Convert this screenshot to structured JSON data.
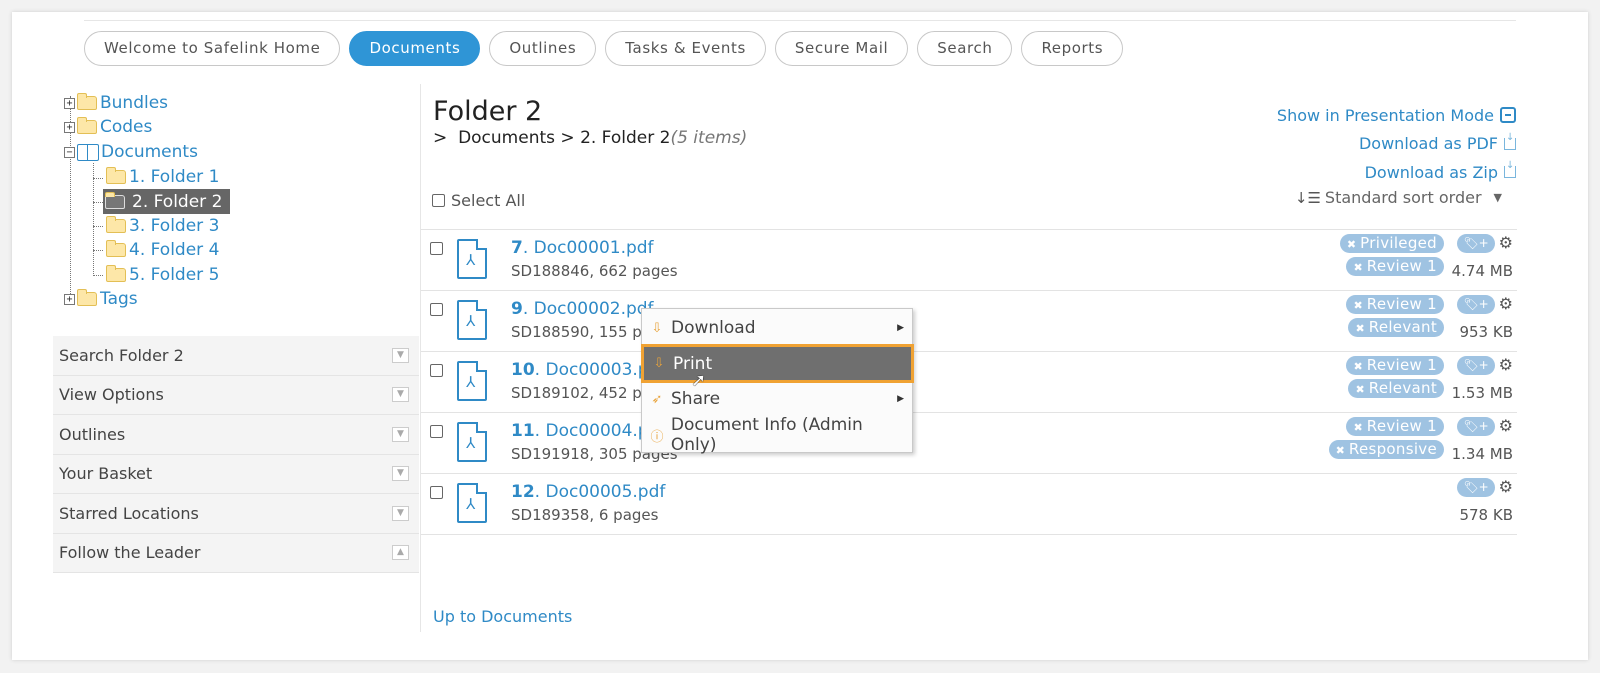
{
  "nav": {
    "tabs": [
      {
        "label": "Welcome to Safelink Home",
        "active": false
      },
      {
        "label": "Documents",
        "active": true
      },
      {
        "label": "Outlines",
        "active": false
      },
      {
        "label": "Tasks & Events",
        "active": false
      },
      {
        "label": "Secure Mail",
        "active": false
      },
      {
        "label": "Search",
        "active": false
      },
      {
        "label": "Reports",
        "active": false
      }
    ]
  },
  "tree": {
    "bundles": "Bundles",
    "codes": "Codes",
    "documents": "Documents",
    "folder1": "1. Folder 1",
    "folder2": "2. Folder 2",
    "folder3": "3. Folder 3",
    "folder4": "4. Folder 4",
    "folder5": "5. Folder 5",
    "tags": "Tags"
  },
  "sidebar": {
    "panels": [
      "Search Folder 2",
      "View Options",
      "Outlines",
      "Your Basket",
      "Starred Locations",
      "Follow the Leader"
    ]
  },
  "main": {
    "title": "Folder 2",
    "crumb_root": ">",
    "crumb_documents": "Documents",
    "crumb_sep": ">",
    "crumb_current": "2. Folder 2",
    "crumb_count": "(5 items)",
    "show_presentation": "Show in Presentation Mode",
    "download_pdf": "Download as PDF",
    "download_zip": "Download as Zip",
    "select_all": "Select All",
    "sort": "Standard sort order",
    "up_link": "Up to Documents"
  },
  "documents": [
    {
      "num": "7",
      "name": "Doc00001.pdf",
      "meta": "SD188846, 662 pages",
      "badges": [
        "Privileged",
        "Review 1"
      ],
      "size": "4.74 MB"
    },
    {
      "num": "9",
      "name": "Doc00002.pdf",
      "meta": "SD188590, 155 pages",
      "badges": [
        "Review 1",
        "Relevant"
      ],
      "size": "953 KB"
    },
    {
      "num": "10",
      "name": "Doc00003.pdf",
      "meta": "SD189102, 452 pages",
      "badges": [
        "Review 1",
        "Relevant"
      ],
      "size": "1.53 MB"
    },
    {
      "num": "11",
      "name": "Doc00004.pdf",
      "meta": "SD191918, 305 pages",
      "badges": [
        "Review 1",
        "Responsive"
      ],
      "size": "1.34 MB"
    },
    {
      "num": "12",
      "name": "Doc00005.pdf",
      "meta": "SD189358, 6 pages",
      "badges": [],
      "size": "578 KB"
    }
  ],
  "context_menu": {
    "download": "Download",
    "print": "Print",
    "share": "Share",
    "info": "Document Info (Admin Only)"
  },
  "colors": {
    "accent": "#2f95d6",
    "link": "#2f8ac6",
    "badge": "#9fc3e2",
    "highlight_border": "#f0a233"
  }
}
